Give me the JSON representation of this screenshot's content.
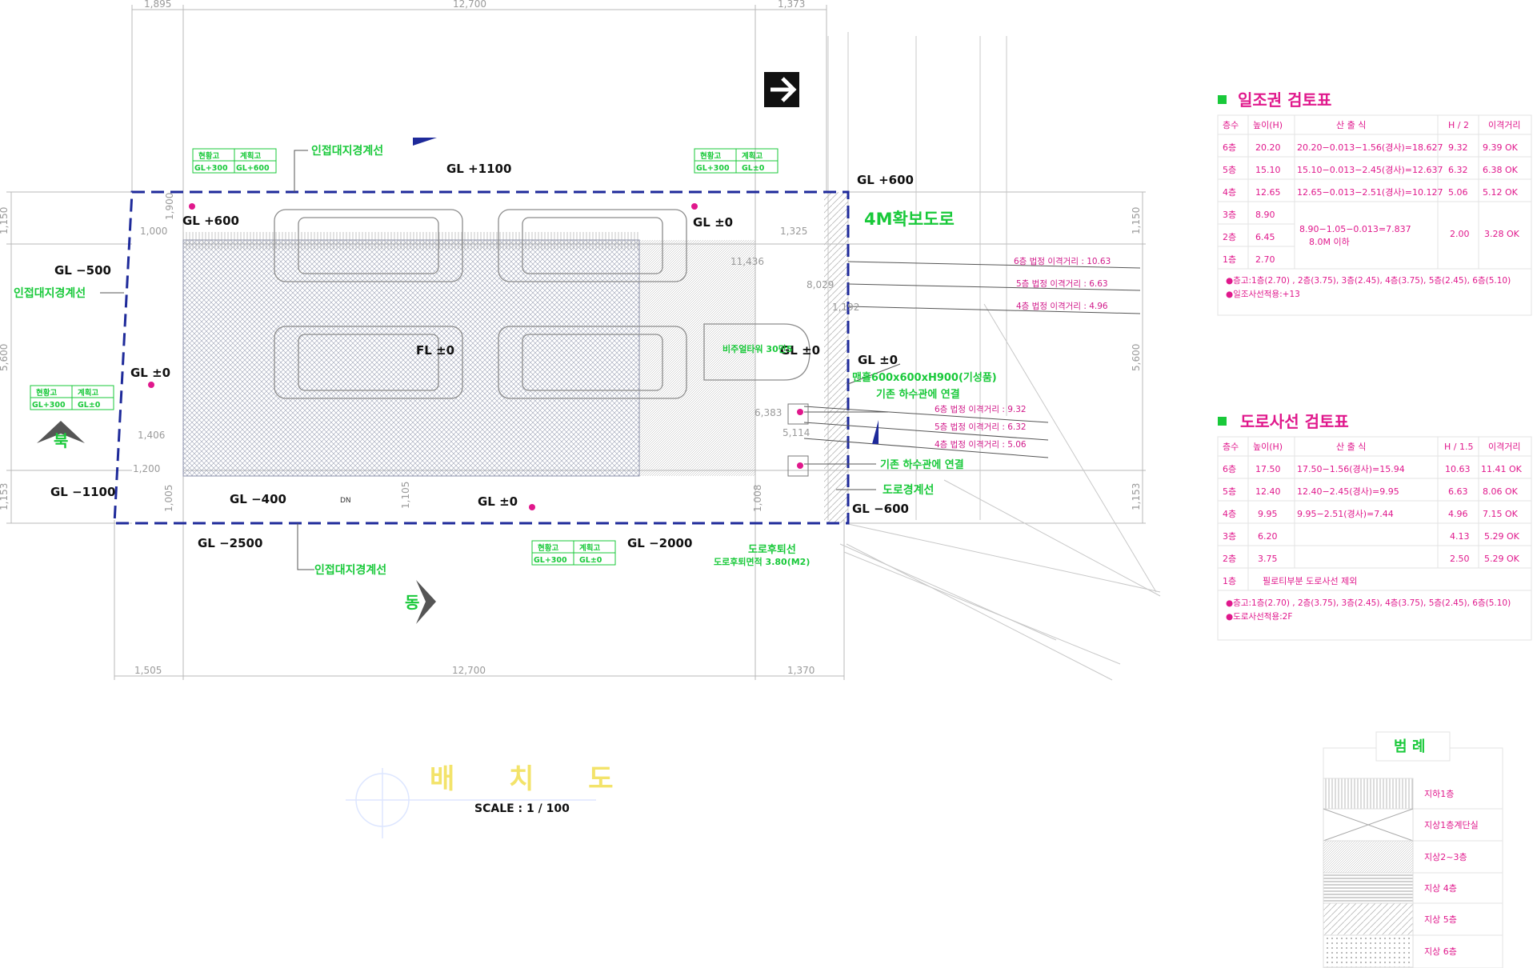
{
  "drawing": {
    "title": "배 치 도",
    "scale": "SCALE : 1 / 100",
    "road": "4M확보도로",
    "floor_level": "FL ±0",
    "levels": [
      {
        "id": "gl-1100-top",
        "text": "GL +1100"
      },
      {
        "id": "gl-600-top-left",
        "text": "GL +600"
      },
      {
        "id": "gl-600-top-right",
        "text": "GL +600"
      },
      {
        "id": "gl-0-top",
        "text": "GL ±0"
      },
      {
        "id": "gl-minus500",
        "text": "GL −500"
      },
      {
        "id": "gl-0-left",
        "text": "GL ±0"
      },
      {
        "id": "gl-0-mid",
        "text": "GL ±0"
      },
      {
        "id": "gl-0-right",
        "text": "GL ±0"
      },
      {
        "id": "gl-minus1100",
        "text": "GL −1100"
      },
      {
        "id": "gl-minus400",
        "text": "GL −400"
      },
      {
        "id": "gl-0-bottom",
        "text": "GL ±0"
      },
      {
        "id": "gl-minus600",
        "text": "GL −600"
      },
      {
        "id": "gl-minus2500",
        "text": "GL −2500"
      },
      {
        "id": "gl-minus2000",
        "text": "GL −2000"
      }
    ],
    "labels": {
      "neighbor_top": "인접대지경계선",
      "neighbor_left": "인접대지경계선",
      "neighbor_bottom": "인접대지경계선",
      "road_boundary": "도로경계선",
      "road_setback": "도로후퇴선",
      "road_setback_area": "도로후퇴면적 3.80(M2)",
      "manhole": "맨홀600x600xH900(기성품)",
      "connect_1": "기존 하수관에 연결",
      "connect_2": "기존 하수관에 연결",
      "parking": "비주얼타워 30만5",
      "dn": "DN",
      "north_mark": "북",
      "east_mark": "동"
    },
    "level_boxes": [
      {
        "id": "box-top-left",
        "h1": "현황고",
        "h2": "계획고",
        "v1": "GL+300",
        "v2": "GL+600"
      },
      {
        "id": "box-top-right",
        "h1": "현황고",
        "h2": "계획고",
        "v1": "GL+300",
        "v2": "GL±0"
      },
      {
        "id": "box-left",
        "h1": "현황고",
        "h2": "계획고",
        "v1": "GL+300",
        "v2": "GL±0"
      },
      {
        "id": "box-bottom",
        "h1": "현황고",
        "h2": "계획고",
        "v1": "GL+300",
        "v2": "GL±0"
      }
    ],
    "dimensions": {
      "top": [
        "1,895",
        "12,700",
        "1,373"
      ],
      "bottom": [
        "1,505",
        "12,700",
        "1,370"
      ],
      "left": [
        "1,150",
        "5,600",
        "1,153"
      ],
      "right": [
        "1,150",
        "5,600",
        "1,153"
      ],
      "inner": [
        "1,000",
        "1,900",
        "1,325",
        "11,436",
        "8,029",
        "1,406",
        "1,200",
        "1,005",
        "1,105",
        "1,008",
        "5,114",
        "6,383",
        "1,192"
      ]
    },
    "separations_upper": [
      "6층 법정 이격거리 : 10.63",
      "5층 법정 이격거리 : 6.63",
      "4층 법정 이격거리 : 4.96"
    ],
    "separations_lower": [
      "6층 법정 이격거리 : 9.32",
      "5층 법정 이격거리 : 6.32",
      "4층 법정 이격거리 : 5.06"
    ]
  },
  "sunlight_table": {
    "title": "일조권 검토표",
    "headers": [
      "층수",
      "높이(H)",
      "산 출 식",
      "H / 2",
      "이격거리"
    ],
    "rows": [
      [
        "6층",
        "20.20",
        "20.20−0.013−1.56(경사)=18.627",
        "9.32",
        "9.39 OK"
      ],
      [
        "5층",
        "15.10",
        "15.10−0.013−2.45(경사)=12.637",
        "6.32",
        "6.38 OK"
      ],
      [
        "4층",
        "12.65",
        "12.65−0.013−2.51(경사)=10.127",
        "5.06",
        "5.12 OK"
      ],
      [
        "3층",
        "8.90",
        "",
        "",
        ""
      ],
      [
        "2층",
        "6.45",
        "",
        "",
        ""
      ],
      [
        "1층",
        "2.70",
        "",
        "",
        ""
      ]
    ],
    "merged_formula_line1": "8.90−1.05−0.013=7.837",
    "merged_formula_line2": "8.0M 이하",
    "merged_h": "2.00",
    "merged_distance": "3.28 OK",
    "notes": [
      "●층고:1층(2.70) , 2층(3.75), 3층(2.45), 4층(3.75), 5층(2.45), 6층(5.10)",
      "●일조사선적용:+13"
    ]
  },
  "road_table": {
    "title": "도로사선 검토표",
    "headers": [
      "층수",
      "높이(H)",
      "산 출 식",
      "H / 1.5",
      "이격거리"
    ],
    "rows": [
      [
        "6층",
        "17.50",
        "17.50−1.56(경사)=15.94",
        "10.63",
        "11.41 OK"
      ],
      [
        "5층",
        "12.40",
        "12.40−2.45(경사)=9.95",
        "6.63",
        "8.06 OK"
      ],
      [
        "4층",
        "9.95",
        "9.95−2.51(경사)=7.44",
        "4.96",
        "7.15 OK"
      ],
      [
        "3층",
        "6.20",
        "",
        "4.13",
        "5.29 OK"
      ],
      [
        "2층",
        "3.75",
        "",
        "2.50",
        "5.29 OK"
      ],
      [
        "1층",
        "필로티부분 도로사선 제외",
        "",
        "",
        ""
      ]
    ],
    "notes": [
      "●층고:1층(2.70) , 2층(3.75), 3층(2.45), 4층(3.75), 5층(2.45), 6층(5.10)",
      "●도로사선적용:2F"
    ]
  },
  "legend": {
    "title": "범 례",
    "items": [
      "지하1층",
      "지상1층계단실",
      "지상2~3층",
      "지상 4층",
      "지상 5층",
      "지상 6층"
    ]
  },
  "colors": {
    "boundary": "#1e2a9a",
    "green_text": "#19c93a",
    "magenta_text": "#e0188c",
    "title_yellow": "#f3e36a"
  }
}
